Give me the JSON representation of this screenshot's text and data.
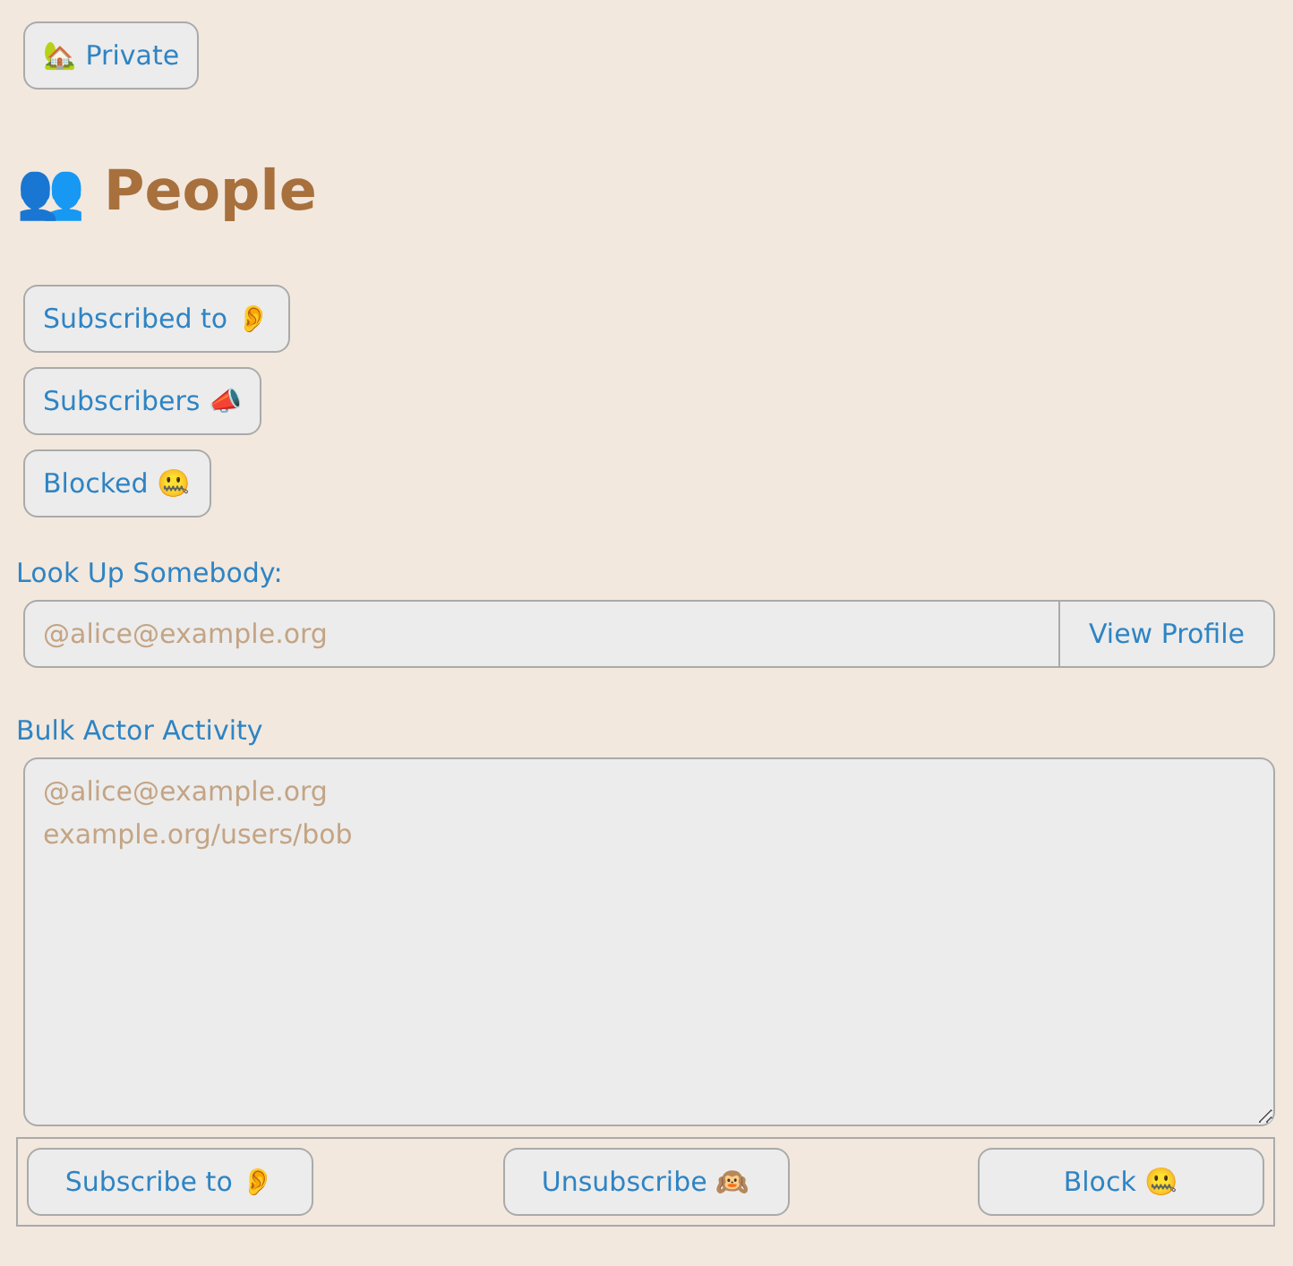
{
  "visibility_button": "🏡 Private",
  "heading": {
    "icon": "👥",
    "title": "People"
  },
  "nav_buttons": [
    "Subscribed to 👂",
    "Subscribers 📣",
    "Blocked 🤐"
  ],
  "lookup": {
    "label": "Look Up Somebody:",
    "placeholder": "@alice@example.org",
    "button": "View Profile"
  },
  "bulk": {
    "label": "Bulk Actor Activity",
    "placeholder": "@alice@example.org\nexample.org/users/bob"
  },
  "actions": [
    "Subscribe to 👂",
    "Unsubscribe 🙉",
    "Block 🤐"
  ]
}
